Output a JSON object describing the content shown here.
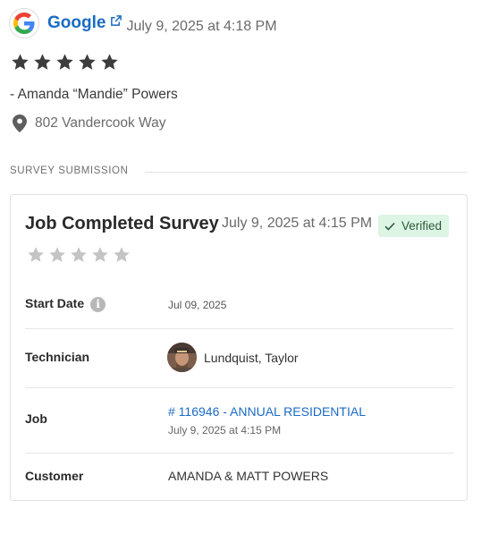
{
  "review": {
    "source": "Google",
    "date": "July 9, 2025 at 4:18 PM",
    "rating": 5,
    "reviewer": "- Amanda “Mandie” Powers",
    "address": "802 Vandercook Way"
  },
  "section_label": "SURVEY SUBMISSION",
  "survey": {
    "title": "Job Completed Survey",
    "date": "July 9, 2025 at 4:15 PM",
    "badge": "Verified",
    "rating": 0,
    "rows": {
      "start_date": {
        "label": "Start Date",
        "value": "Jul 09, 2025",
        "info_glyph": "i"
      },
      "technician": {
        "label": "Technician",
        "value": "Lundquist, Taylor"
      },
      "job": {
        "label": "Job",
        "link": "# 116946 - ANNUAL RESIDENTIAL",
        "sub": "July 9, 2025 at 4:15 PM"
      },
      "customer": {
        "label": "Customer",
        "value": "AMANDA & MATT POWERS"
      }
    }
  },
  "icons": {
    "source_logo": "google-g-logo",
    "external": "external-link-icon",
    "location": "map-pin-icon",
    "info": "info-icon",
    "check": "check-icon",
    "star": "star-icon"
  },
  "colors": {
    "link": "#1a6bc4",
    "star_filled": "#3d3d3d",
    "star_empty": "#c4c4c4",
    "badge_bg": "#dcf5e4",
    "badge_text": "#2e5a3c"
  }
}
